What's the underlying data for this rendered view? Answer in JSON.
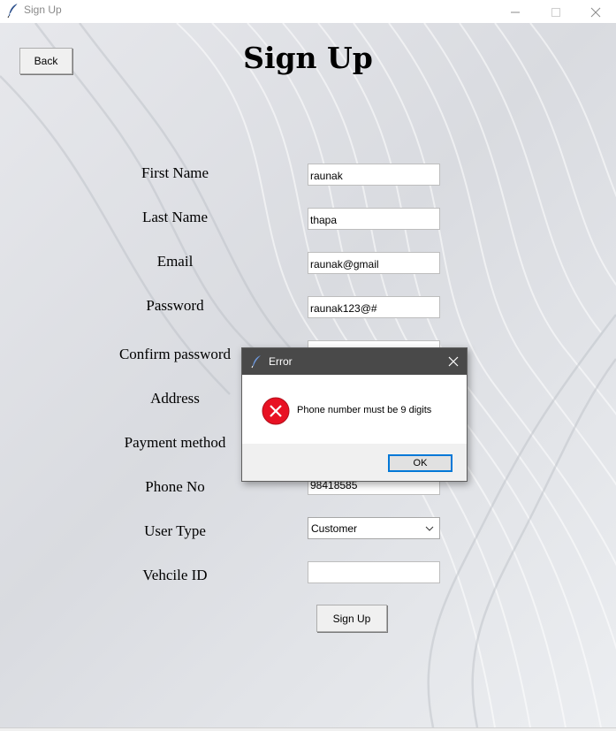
{
  "window": {
    "title": "Sign Up"
  },
  "header": {
    "back_label": "Back",
    "title": "Sign Up"
  },
  "form": {
    "first_name": {
      "label": "First Name",
      "value": "raunak"
    },
    "last_name": {
      "label": "Last Name",
      "value": "thapa"
    },
    "email": {
      "label": "Email",
      "value": "raunak@gmail"
    },
    "password": {
      "label": "Password",
      "value": "raunak123@#"
    },
    "confirm_password": {
      "label": "Confirm password",
      "value": ""
    },
    "address": {
      "label": "Address",
      "value": ""
    },
    "payment_method": {
      "label": "Payment method",
      "value": ""
    },
    "phone_no": {
      "label": "Phone No",
      "value": "98418585"
    },
    "user_type": {
      "label": "User Type",
      "selected": "Customer"
    },
    "vehicle_id": {
      "label": "Vehcile ID",
      "value": ""
    },
    "submit_label": "Sign Up"
  },
  "dialog": {
    "title": "Error",
    "message": "Phone number must be 9 digits",
    "ok_label": "OK",
    "icon": "error-icon"
  },
  "colors": {
    "dialog_titlebar": "#494949",
    "error_red": "#e81123",
    "focus_blue": "#0078d7"
  }
}
